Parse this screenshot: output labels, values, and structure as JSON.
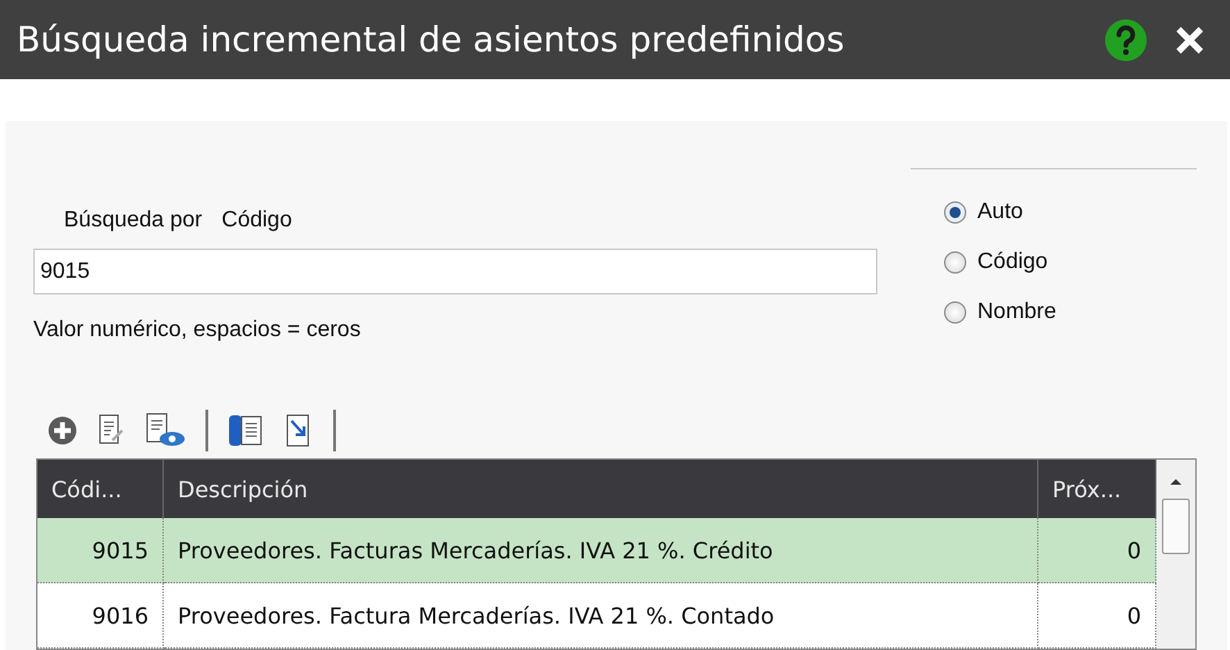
{
  "window": {
    "title": "Búsqueda incremental de asientos predefinidos"
  },
  "search": {
    "label": "Búsqueda por",
    "mode": "Código",
    "value": "9015",
    "hint": "Valor numérico, espacios = ceros"
  },
  "search_options": [
    {
      "label": "Auto",
      "selected": true
    },
    {
      "label": "Código",
      "selected": false
    },
    {
      "label": "Nombre",
      "selected": false
    }
  ],
  "table": {
    "columns": [
      "Códi...",
      "Descripción",
      "Próx..."
    ],
    "rows": [
      {
        "cells": [
          "9015",
          "Proveedores. Facturas Mercaderías. IVA 21 %. Crédito",
          "0"
        ],
        "selected": true
      },
      {
        "cells": [
          "9016",
          "Proveedores. Factura Mercaderías. IVA 21 %. Contado",
          "0"
        ],
        "selected": false
      }
    ]
  }
}
